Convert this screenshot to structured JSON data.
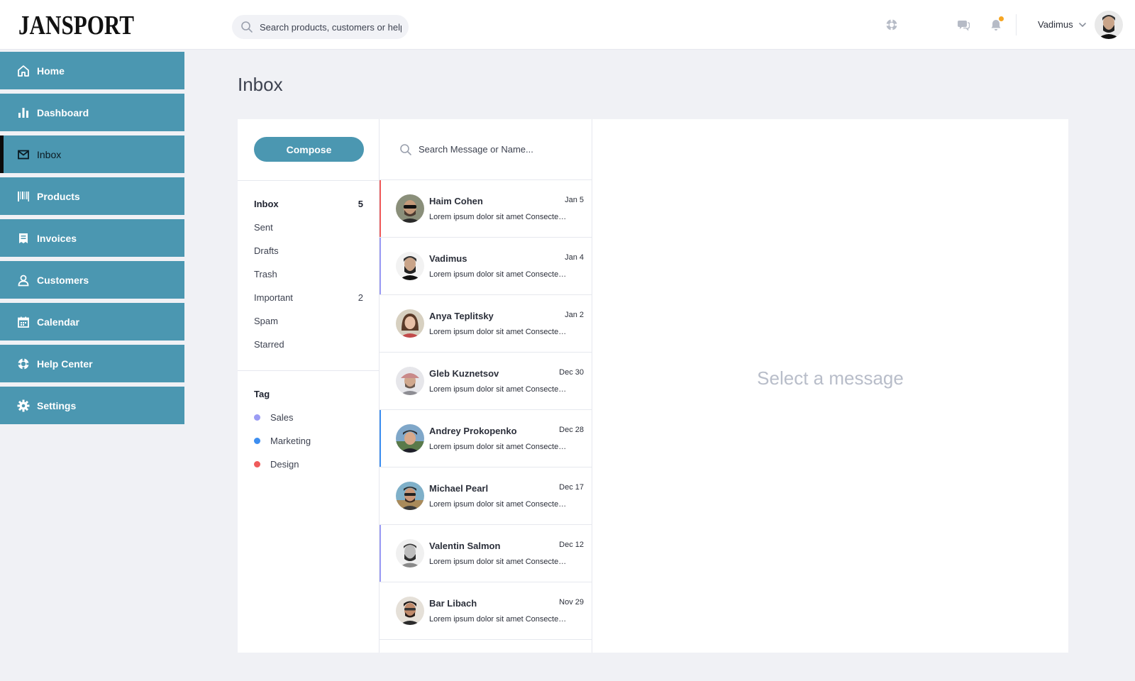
{
  "brand": {
    "logo_text": "JANSPORT"
  },
  "header": {
    "search_placeholder": "Search products, customers or help",
    "user_name": "Vadimus"
  },
  "sidebar": {
    "items": [
      {
        "label": "Home",
        "icon": "home-icon"
      },
      {
        "label": "Dashboard",
        "icon": "bar-chart-icon"
      },
      {
        "label": "Inbox",
        "icon": "mail-icon",
        "active": true
      },
      {
        "label": "Products",
        "icon": "barcode-icon"
      },
      {
        "label": "Invoices",
        "icon": "invoice-icon"
      },
      {
        "label": "Customers",
        "icon": "user-icon"
      },
      {
        "label": "Calendar",
        "icon": "calendar-icon"
      },
      {
        "label": "Help Center",
        "icon": "lifebuoy-icon"
      },
      {
        "label": "Settings",
        "icon": "gear-icon"
      }
    ]
  },
  "page": {
    "title": "Inbox"
  },
  "mailbox": {
    "compose_label": "Compose",
    "folders": [
      {
        "label": "Inbox",
        "count": "5",
        "active": true
      },
      {
        "label": "Sent",
        "count": ""
      },
      {
        "label": "Drafts",
        "count": ""
      },
      {
        "label": "Trash",
        "count": ""
      },
      {
        "label": "Important",
        "count": "2"
      },
      {
        "label": "Spam",
        "count": ""
      },
      {
        "label": "Starred",
        "count": ""
      }
    ],
    "tag_title": "Tag",
    "tags": [
      {
        "label": "Sales",
        "color": "#9b9cf4"
      },
      {
        "label": "Marketing",
        "color": "#3d8ef0"
      },
      {
        "label": "Design",
        "color": "#ef5b5b"
      }
    ]
  },
  "messages": {
    "search_placeholder": "Search Message or Name...",
    "items": [
      {
        "name": "Haim Cohen",
        "date": "Jan 5",
        "preview": "Lorem ipsum dolor sit amet Consectetur adipiscing",
        "accent": "#ef5b5b"
      },
      {
        "name": "Vadimus",
        "date": "Jan 4",
        "preview": "Lorem ipsum dolor sit amet Consectetur adipiscing",
        "accent": "#9b9cf4"
      },
      {
        "name": "Anya Teplitsky",
        "date": "Jan 2",
        "preview": "Lorem ipsum dolor sit amet Consectetur adipiscing",
        "accent": ""
      },
      {
        "name": "Gleb Kuznetsov",
        "date": "Dec 30",
        "preview": "Lorem ipsum dolor sit amet Consectetur adipiscing",
        "accent": ""
      },
      {
        "name": "Andrey Prokopenko",
        "date": "Dec 28",
        "preview": "Lorem ipsum dolor sit amet Consectetur adipiscing",
        "accent": "#3d8ef0"
      },
      {
        "name": "Michael Pearl",
        "date": "Dec 17",
        "preview": "Lorem ipsum dolor sit amet Consectetur adipiscing",
        "accent": ""
      },
      {
        "name": "Valentin Salmon",
        "date": "Dec 12",
        "preview": "Lorem ipsum dolor sit amet Consectetur adipiscing",
        "accent": "#9b9cf4"
      },
      {
        "name": "Bar Libach",
        "date": "Nov 29",
        "preview": "Lorem ipsum dolor sit amet Consectetur adipiscing",
        "accent": ""
      }
    ]
  },
  "reader": {
    "empty_text": "Select a message"
  },
  "colors": {
    "accent": "#4b97b1",
    "background": "#f0f1f5",
    "notification": "#f6a623"
  }
}
